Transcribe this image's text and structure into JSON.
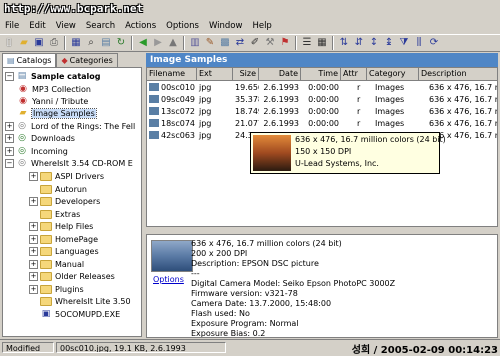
{
  "watermark": "http://www.bcpark.net",
  "menu": [
    "File",
    "Edit",
    "View",
    "Search",
    "Actions",
    "Options",
    "Window",
    "Help"
  ],
  "tabs": {
    "catalogs": "Catalogs",
    "categories": "Categories"
  },
  "tree": {
    "root": "Sample catalog",
    "items": [
      {
        "label": "MP3 Collection"
      },
      {
        "label": "Yanni / Tribute"
      },
      {
        "label": "Image Samples"
      },
      {
        "label": "Lord of the Rings: The Fell"
      },
      {
        "label": "Downloads"
      },
      {
        "label": "Incoming"
      },
      {
        "label": "WhereIsIt 3.54 CD-ROM E"
      },
      {
        "label": "ASPI Drivers"
      },
      {
        "label": "Autorun"
      },
      {
        "label": "Developers"
      },
      {
        "label": "Extras"
      },
      {
        "label": "Help Files"
      },
      {
        "label": "HomePage"
      },
      {
        "label": "Languages"
      },
      {
        "label": "Manual"
      },
      {
        "label": "Older Releases"
      },
      {
        "label": "Plugins"
      },
      {
        "label": "WhereIsIt Lite 3.50"
      },
      {
        "label": "5OCOMUPD.EXE"
      }
    ]
  },
  "gallery_title": "Image Samples",
  "columns": [
    "Filename",
    "Ext",
    "Size",
    "Date",
    "Time",
    "Attr",
    "Category",
    "Description"
  ],
  "rows": [
    [
      "00sc010",
      "jpg",
      "19.656",
      "2.6.1993",
      "0:00:00",
      "r",
      "Images",
      "636 x 476, 16.7 m"
    ],
    [
      "09sc049",
      "jpg",
      "35.378",
      "2.6.1993",
      "0:00:00",
      "r",
      "Images",
      "636 x 476, 16.7 m"
    ],
    [
      "13sc072",
      "jpg",
      "18.749",
      "2.6.1993",
      "0:00:00",
      "r",
      "Images",
      "636 x 476, 16.7 m"
    ],
    [
      "18sc074",
      "jpg",
      "21.077",
      "2.6.1993",
      "0:00:00",
      "r",
      "Images",
      "636 x 476, 16.7 m"
    ],
    [
      "42sc063",
      "jpg",
      "24.39",
      "",
      "",
      "",
      "",
      "636 x 476, 16.7 m"
    ]
  ],
  "tooltip": {
    "line1": "636 x 476, 16.7 million colors (24 bit)",
    "line2": "150 x 150 DPI",
    "line3": "U-Lead Systems, Inc."
  },
  "details": {
    "options_link": "Options",
    "lines": [
      "636 x 476, 16.7 million colors (24 bit)",
      "200 x 200 DPI",
      "Description: EPSON DSC picture",
      "---",
      "Digital Camera Model: Seiko Epson PhotoPC 3000Z",
      "Firmware version: v321-78",
      "Camera Date: 13.7.2000, 15:48:00",
      "Flash used: No",
      "Exposure Program: Normal",
      "Exposure Bias: 0.2"
    ]
  },
  "status": {
    "mode": "Modified",
    "file": "00sc010.jpg, 19.1 KB, 2.6.1993",
    "stamp": "성희 / 2005-02-09 00:14:23"
  }
}
